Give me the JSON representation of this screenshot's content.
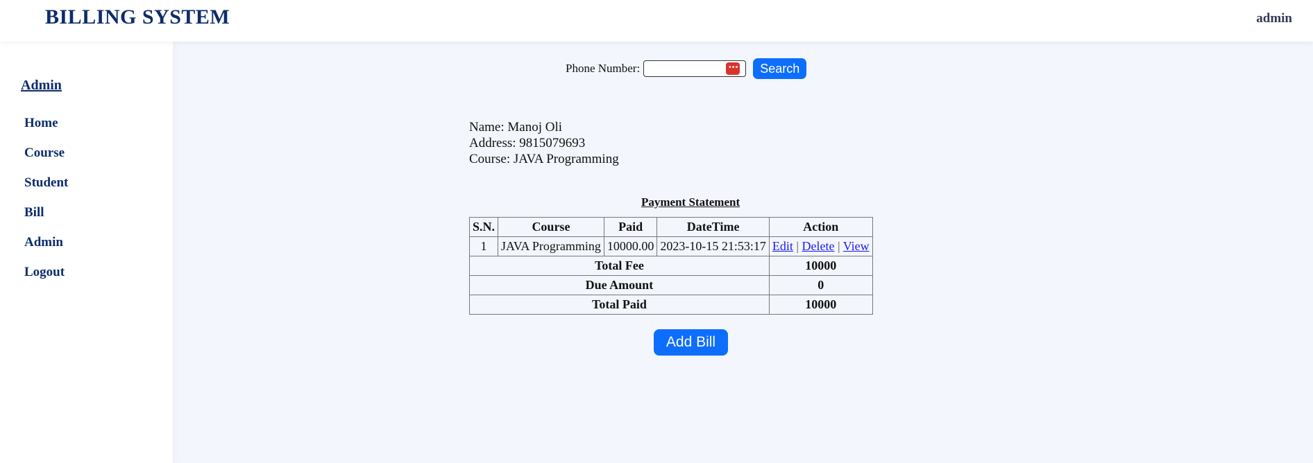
{
  "header": {
    "brand": "BILLING SYSTEM",
    "user": "admin"
  },
  "sidebar": {
    "title": "Admin",
    "items": [
      {
        "label": "Home"
      },
      {
        "label": "Course"
      },
      {
        "label": "Student"
      },
      {
        "label": "Bill"
      },
      {
        "label": "Admin"
      },
      {
        "label": "Logout"
      }
    ]
  },
  "search": {
    "label": "Phone Number:",
    "value": "",
    "button_label": "Search",
    "icon": "password-manager-icon",
    "icon_glyph": "•••"
  },
  "student": {
    "name": "Name: Manoj Oli",
    "address": "Address: 9815079693",
    "course": "Course: JAVA Programming"
  },
  "statement": {
    "title": "Payment Statement",
    "columns": [
      "S.N.",
      "Course",
      "Paid",
      "DateTime",
      "Action"
    ],
    "rows": [
      {
        "sn": "1",
        "course": "JAVA Programming",
        "paid": "10000.00",
        "datetime": "2023-10-15 21:53:17",
        "edit": "Edit",
        "delete": "Delete",
        "view": "View",
        "separator": "|"
      }
    ],
    "totals": [
      {
        "label": "Total Fee",
        "value": "10000"
      },
      {
        "label": "Due Amount",
        "value": "0"
      },
      {
        "label": "Total Paid",
        "value": "10000"
      }
    ]
  },
  "add_bill_label": "Add Bill",
  "colors": {
    "brand": "#0d2c6b",
    "primary_button": "#0d6efd",
    "background": "#f3f6fc",
    "link": "#1a1aee"
  }
}
